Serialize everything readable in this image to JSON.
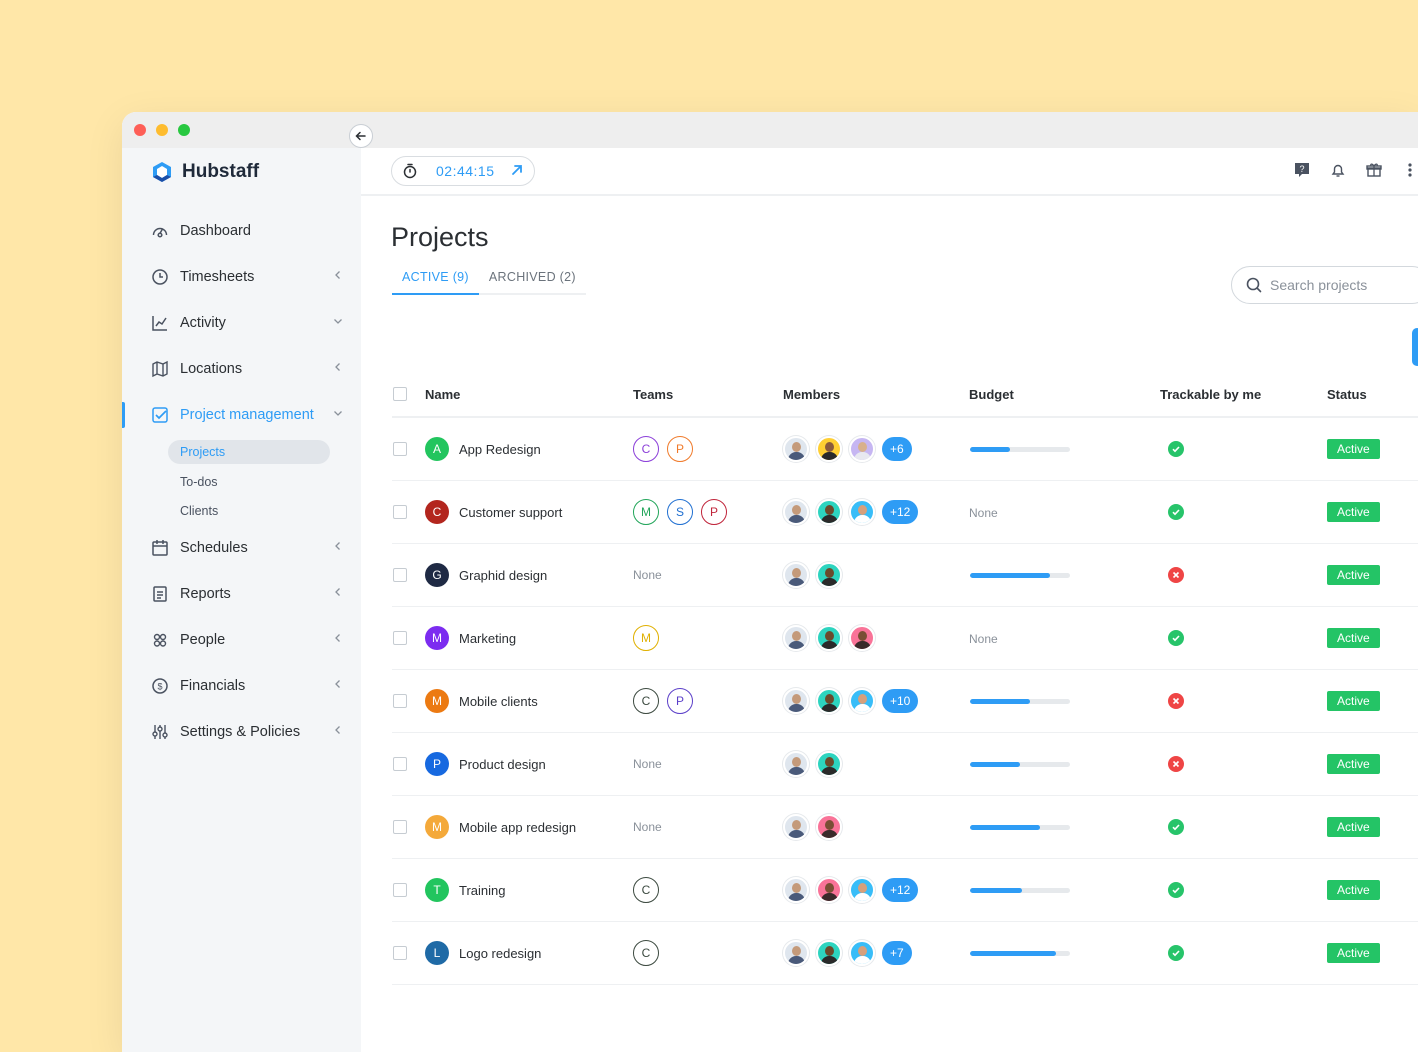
{
  "app": {
    "name": "Hubstaff"
  },
  "timer": {
    "value": "02:44:15"
  },
  "sidebar": {
    "items": [
      {
        "id": "dashboard",
        "label": "Dashboard",
        "icon": "dashboard-icon",
        "chevron": ""
      },
      {
        "id": "timesheets",
        "label": "Timesheets",
        "icon": "clock-icon",
        "chevron": "left"
      },
      {
        "id": "activity",
        "label": "Activity",
        "icon": "chart-line-icon",
        "chevron": "down"
      },
      {
        "id": "locations",
        "label": "Locations",
        "icon": "map-icon",
        "chevron": "left"
      },
      {
        "id": "project-management",
        "label": "Project management",
        "icon": "checkbox-icon",
        "chevron": "down",
        "active": true
      },
      {
        "id": "schedules",
        "label": "Schedules",
        "icon": "calendar-icon",
        "chevron": "left"
      },
      {
        "id": "reports",
        "label": "Reports",
        "icon": "report-icon",
        "chevron": "left"
      },
      {
        "id": "people",
        "label": "People",
        "icon": "people-icon",
        "chevron": "left"
      },
      {
        "id": "financials",
        "label": "Financials",
        "icon": "dollar-icon",
        "chevron": "left"
      },
      {
        "id": "settings",
        "label": "Settings & Policies",
        "icon": "sliders-icon",
        "chevron": "left"
      }
    ],
    "subitems": [
      {
        "label": "Projects",
        "active": true
      },
      {
        "label": "To-dos"
      },
      {
        "label": "Clients"
      }
    ]
  },
  "page": {
    "title": "Projects",
    "tabs": [
      {
        "label": "ACTIVE (9)",
        "active": true
      },
      {
        "label": "ARCHIVED (2)"
      }
    ],
    "search_placeholder": "Search projects"
  },
  "table": {
    "headers": {
      "name": "Name",
      "teams": "Teams",
      "members": "Members",
      "budget": "Budget",
      "trackable": "Trackable by me",
      "status": "Status"
    },
    "none_label": "None",
    "rows": [
      {
        "initial": "A",
        "color": "#22c55e",
        "name": "App Redesign",
        "teams": [
          {
            "l": "C",
            "c": "#8b3fd9"
          },
          {
            "l": "P",
            "c": "#f07a2a"
          }
        ],
        "members": 3,
        "more": "+6",
        "budget": 0.4,
        "trackable": true,
        "status": "Active"
      },
      {
        "initial": "C",
        "color": "#b3261e",
        "name": "Customer support",
        "teams": [
          {
            "l": "M",
            "c": "#22a55a"
          },
          {
            "l": "S",
            "c": "#1f6fd1"
          },
          {
            "l": "P",
            "c": "#c0243a"
          }
        ],
        "members": 3,
        "more": "+12",
        "budget": null,
        "trackable": true,
        "status": "Active"
      },
      {
        "initial": "G",
        "color": "#1f2a44",
        "name": "Graphid design",
        "teams": [],
        "members": 2,
        "more": "",
        "budget": 0.8,
        "trackable": false,
        "status": "Active"
      },
      {
        "initial": "M",
        "color": "#7c2cf0",
        "name": "Marketing",
        "teams": [
          {
            "l": "M",
            "c": "#e0b000"
          }
        ],
        "members": 3,
        "more": "",
        "budget": null,
        "trackable": true,
        "status": "Active"
      },
      {
        "initial": "M",
        "color": "#ec7a12",
        "name": "Mobile clients",
        "teams": [
          {
            "l": "C",
            "c": "#3c4a40"
          },
          {
            "l": "P",
            "c": "#5b3fc9"
          }
        ],
        "members": 3,
        "more": "+10",
        "budget": 0.6,
        "trackable": false,
        "status": "Active"
      },
      {
        "initial": "P",
        "color": "#1769e0",
        "name": "Product design",
        "teams": [],
        "members": 2,
        "more": "",
        "budget": 0.5,
        "trackable": false,
        "status": "Active"
      },
      {
        "initial": "M",
        "color": "#f4a93a",
        "name": "Mobile app redesign",
        "teams": [],
        "members": 2,
        "more": "",
        "budget": 0.7,
        "trackable": true,
        "status": "Active"
      },
      {
        "initial": "T",
        "color": "#22c55e",
        "name": "Training",
        "teams": [
          {
            "l": "C",
            "c": "#3c4a40"
          }
        ],
        "members": 3,
        "more": "+12",
        "budget": 0.52,
        "trackable": true,
        "status": "Active"
      },
      {
        "initial": "L",
        "color": "#1f6aa6",
        "name": "Logo redesign",
        "teams": [
          {
            "l": "C",
            "c": "#3c4a40"
          }
        ],
        "members": 3,
        "more": "+7",
        "budget": 0.86,
        "trackable": true,
        "status": "Active"
      }
    ]
  }
}
